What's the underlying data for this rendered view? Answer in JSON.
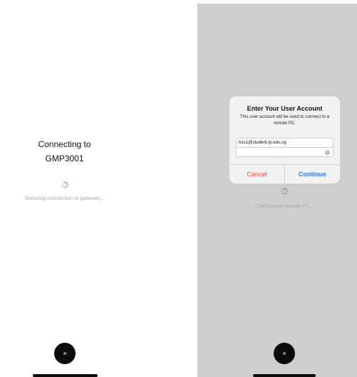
{
  "left_screen": {
    "title_line1": "Connecting to",
    "title_line2": "GMP3001",
    "status": "Securing connection to gateway...",
    "close_label": "×"
  },
  "right_screen": {
    "status": "Configuring remote PC...",
    "close_label": "×",
    "dialog": {
      "title": "Enter Your User Account",
      "message": "This user account will be used to connect to a remote PC.",
      "username_value": "hss1@student.tp.edu.sg",
      "password_value": "",
      "clear_label": "×",
      "cancel_label": "Cancel",
      "continue_label": "Continue"
    }
  },
  "colors": {
    "overlay_gray": "#cfcfcf",
    "cancel_red": "#ef4e46",
    "continue_blue": "#2f7cf6"
  },
  "icons": {
    "spinner": "loading-spinner-icon",
    "close": "close-icon",
    "clear": "clear-text-icon"
  }
}
